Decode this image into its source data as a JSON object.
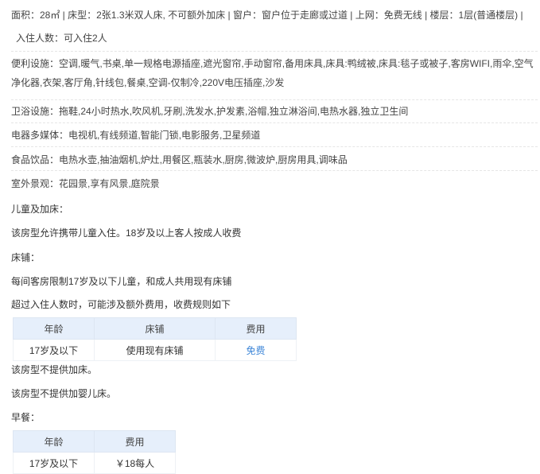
{
  "summary": {
    "line1": "面积：28㎡ | 床型：2张1.3米双人床, 不可额外加床 | 窗户：窗户位于走廊或过道 | 上网：免费无线 | 楼层：1层(普通楼层) |",
    "line2": "入住人数：可入住2人"
  },
  "amenities": [
    {
      "label": "便利设施：",
      "value": "空调,暖气,书桌,单一规格电源插座,遮光窗帘,手动窗帘,备用床具,床具:鸭绒被,床具:毯子或被子,客房WIFI,雨伞,空气净化器,衣架,客厅角,针线包,餐桌,空调-仅制冷,220V电压插座,沙发"
    },
    {
      "label": "卫浴设施：",
      "value": "拖鞋,24小时热水,吹风机,牙刷,洗发水,护发素,浴帽,独立淋浴间,电热水器,独立卫生间"
    },
    {
      "label": "电器多媒体：",
      "value": "电视机,有线频道,智能门锁,电影服务,卫星频道"
    },
    {
      "label": "食品饮品：",
      "value": "电热水壶,抽油烟机,炉灶,用餐区,瓶装水,厨房,微波炉,厨房用具,调味品"
    },
    {
      "label": "室外景观：",
      "value": "花园景,享有风景,庭院景"
    }
  ],
  "policy": {
    "children_title": "儿童及加床：",
    "children_text": "该房型允许携带儿童入住。18岁及以上客人按成人收费",
    "bed_title": "床铺：",
    "bed_text": "每间客房限制17岁及以下儿童，和成人共用现有床铺",
    "over_text": "超过入住人数时，可能涉及额外费用，收费规则如下",
    "bed_table": {
      "headers": [
        "年龄",
        "床铺",
        "费用"
      ],
      "row": [
        "17岁及以下",
        "使用现有床铺",
        "免费"
      ]
    },
    "no_extra_bed": "该房型不提供加床。",
    "no_crib": "该房型不提供加婴儿床。",
    "breakfast_title": "早餐：",
    "breakfast_table": {
      "headers": [
        "年龄",
        "费用"
      ],
      "row": [
        "17岁及以下",
        "￥18每人"
      ]
    }
  },
  "colors": {
    "table_header": "#e6effb",
    "free_link": "#3f87d8",
    "divider": "#e5e5e5"
  }
}
